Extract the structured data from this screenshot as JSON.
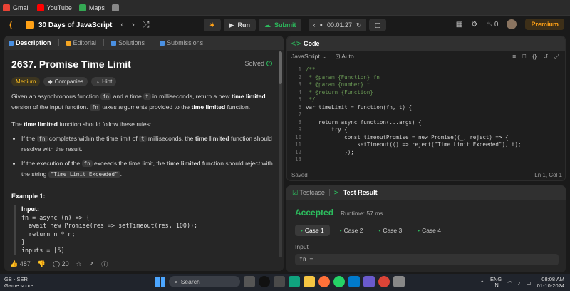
{
  "bookmarks": [
    {
      "label": "Gmail",
      "color": "#ea4335"
    },
    {
      "label": "YouTube",
      "color": "#ff0000"
    },
    {
      "label": "Maps",
      "color": "#34a853"
    }
  ],
  "nav": {
    "logo_glyph": "⟨",
    "study_title": "30 Days of JavaScript",
    "run_label": "Run",
    "submit_label": "Submit",
    "timer": "00:01:27",
    "streak": "0",
    "premium_label": "Premium"
  },
  "description": {
    "tabs": [
      {
        "label": "Description",
        "color": "#4a90e2"
      },
      {
        "label": "Editorial",
        "color": "#f5a623"
      },
      {
        "label": "Solutions",
        "color": "#4a90e2"
      },
      {
        "label": "Submissions",
        "color": "#4a90e2"
      }
    ],
    "title": "2637. Promise Time Limit",
    "status": "Solved",
    "badges": [
      "Medium",
      "Companies",
      "Hint"
    ],
    "p1": {
      "a": "Given an asynchronous function ",
      "code_fn": "fn",
      "b": " and a time ",
      "code_t": "t",
      "c": " in milliseconds, return a new ",
      "bold": "time limited",
      "d": " version of the input function. ",
      "code_fn2": "fn",
      "e": " takes arguments provided to the ",
      "bold2": "time limited",
      "f": " function."
    },
    "p2": {
      "a": "The ",
      "bold": "time limited",
      "b": " function should follow these rules:"
    },
    "rule1": {
      "a": "If the ",
      "code_fn": "fn",
      "b": " completes within the time limit of ",
      "code_t": "t",
      "c": " milliseconds, the ",
      "bold": "time limited",
      "d": " function should resolve with the result."
    },
    "rule2": {
      "a": "If the execution of the ",
      "code_fn": "fn",
      "b": " exceeds the time limit, the ",
      "bold": "time limited",
      "c": " function should reject with the string ",
      "code_str": "\"Time Limit Exceeded\"",
      "d": "."
    },
    "example_heading": "Example 1:",
    "example_input_label": "Input:",
    "example_lines": [
      "fn = async (n) => {",
      "  await new Promise(res => setTimeout(res, 100));",
      "  return n * n;",
      "}",
      "inputs = [5]"
    ],
    "likes": "487",
    "comments": "20"
  },
  "code": {
    "header": "Code",
    "language": "JavaScript",
    "mode": "Auto",
    "saved": "Saved",
    "cursor": "Ln 1, Col 1",
    "lines": [
      {
        "n": "1",
        "t": "/**",
        "c": "cm"
      },
      {
        "n": "2",
        "t": " * @param {Function} fn",
        "c": "cm"
      },
      {
        "n": "3",
        "t": " * @param {number} t",
        "c": "cm"
      },
      {
        "n": "4",
        "t": " * @return {Function}",
        "c": "cm"
      },
      {
        "n": "5",
        "t": " */",
        "c": "cm"
      },
      {
        "n": "6",
        "t": "var timeLimit = function(fn, t) {",
        "c": "tx"
      },
      {
        "n": "7",
        "t": "",
        "c": "tx"
      },
      {
        "n": "8",
        "t": "    return async function(...args) {",
        "c": "tx"
      },
      {
        "n": "9",
        "t": "        try {",
        "c": "tx"
      },
      {
        "n": "10",
        "t": "            const timeoutPromise = new Promise((_, reject) => {",
        "c": "tx"
      },
      {
        "n": "11",
        "t": "                setTimeout(() => reject(\"Time Limit Exceeded\"), t);",
        "c": "tx"
      },
      {
        "n": "12",
        "t": "            });",
        "c": "tx"
      },
      {
        "n": "13",
        "t": "",
        "c": "tx"
      }
    ]
  },
  "test": {
    "tab1": "Testcase",
    "tab2": "Test Result",
    "verdict": "Accepted",
    "runtime": "Runtime: 57 ms",
    "cases": [
      "Case 1",
      "Case 2",
      "Case 3",
      "Case 4"
    ],
    "input_label": "Input",
    "input_value": "fn ="
  },
  "taskbar": {
    "weather_line1": "GB - SER",
    "weather_line2": "Game score",
    "search": "Search",
    "lang_line1": "ENG",
    "lang_line2": "IN",
    "time": "08:08 AM",
    "date": "01-10-2024"
  }
}
